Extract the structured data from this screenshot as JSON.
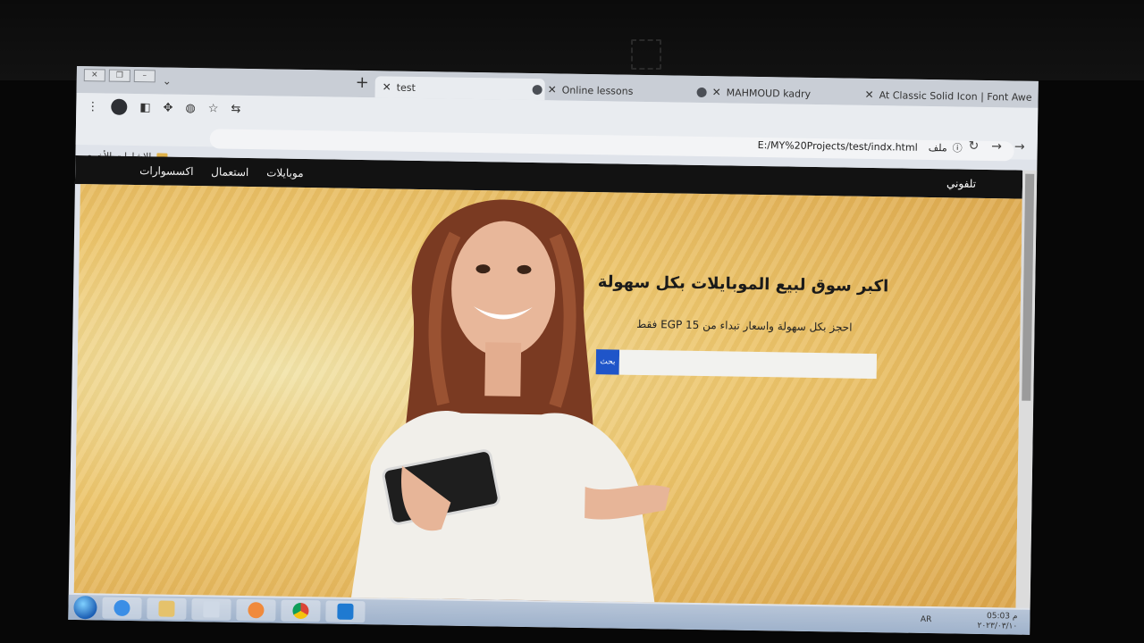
{
  "browser": {
    "tabs": [
      {
        "label": "test",
        "active": true
      },
      {
        "label": "Online lessons",
        "active": false
      },
      {
        "label": "MAHMOUD kadry",
        "active": false
      },
      {
        "label": "At Classic Solid Icon | Font Awe",
        "active": false
      }
    ],
    "new_tab_symbol": "+",
    "url": "E:/MY%20Projects/test/indx.html",
    "site_info_label": "ملف",
    "bookmarks_label": "الإشارات الأخرى"
  },
  "page": {
    "brand": "تلفوني",
    "nav": [
      "موبايلات",
      "استعمال",
      "اكسسوارات"
    ],
    "hero_title": "اكبر سوق لبيع الموبايلات بكل سهولة",
    "hero_subtitle": "احجز بكل سهولة واسعار تبداء من EGP 15 فقط",
    "search_button": "بحث",
    "search_placeholder": ""
  },
  "taskbar": {
    "language": "AR",
    "time": "05:03 م",
    "date": "٢٠٢٣/٠٣/١٠"
  },
  "colors": {
    "navbar": "#121212",
    "hero_bg": "#ecc46a",
    "search_button": "#1f55c9"
  }
}
